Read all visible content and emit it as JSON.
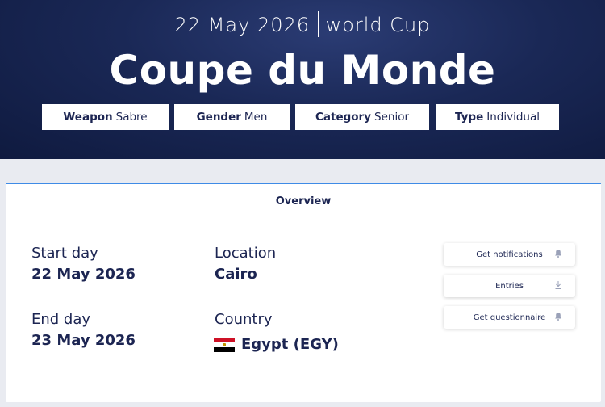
{
  "hero": {
    "date": "22 May 2026",
    "competition_type": "world Cup",
    "title": "Coupe du Monde",
    "chips": [
      {
        "key": "Weapon",
        "value": "Sabre"
      },
      {
        "key": "Gender",
        "value": "Men"
      },
      {
        "key": "Category",
        "value": "Senior"
      },
      {
        "key": "Type",
        "value": "Individual"
      }
    ]
  },
  "overview": {
    "tab_label": "Overview",
    "start_label": "Start day",
    "start_value": "22 May 2026",
    "end_label": "End day",
    "end_value": "23 May 2026",
    "location_label": "Location",
    "location_value": "Cairo",
    "country_label": "Country",
    "country_value": "Egypt (EGY)",
    "country_flag": "egypt-flag"
  },
  "actions": [
    {
      "label": "Get notifications",
      "icon": "bell-icon"
    },
    {
      "label": "Entries",
      "icon": "download-icon"
    },
    {
      "label": "Get questionnaire",
      "icon": "bell-icon"
    }
  ],
  "colors": {
    "hero_bg": "#1a2856",
    "text_navy": "#1c2552",
    "accent_blue": "#3f8be6",
    "page_bg": "#e9ebf1"
  }
}
